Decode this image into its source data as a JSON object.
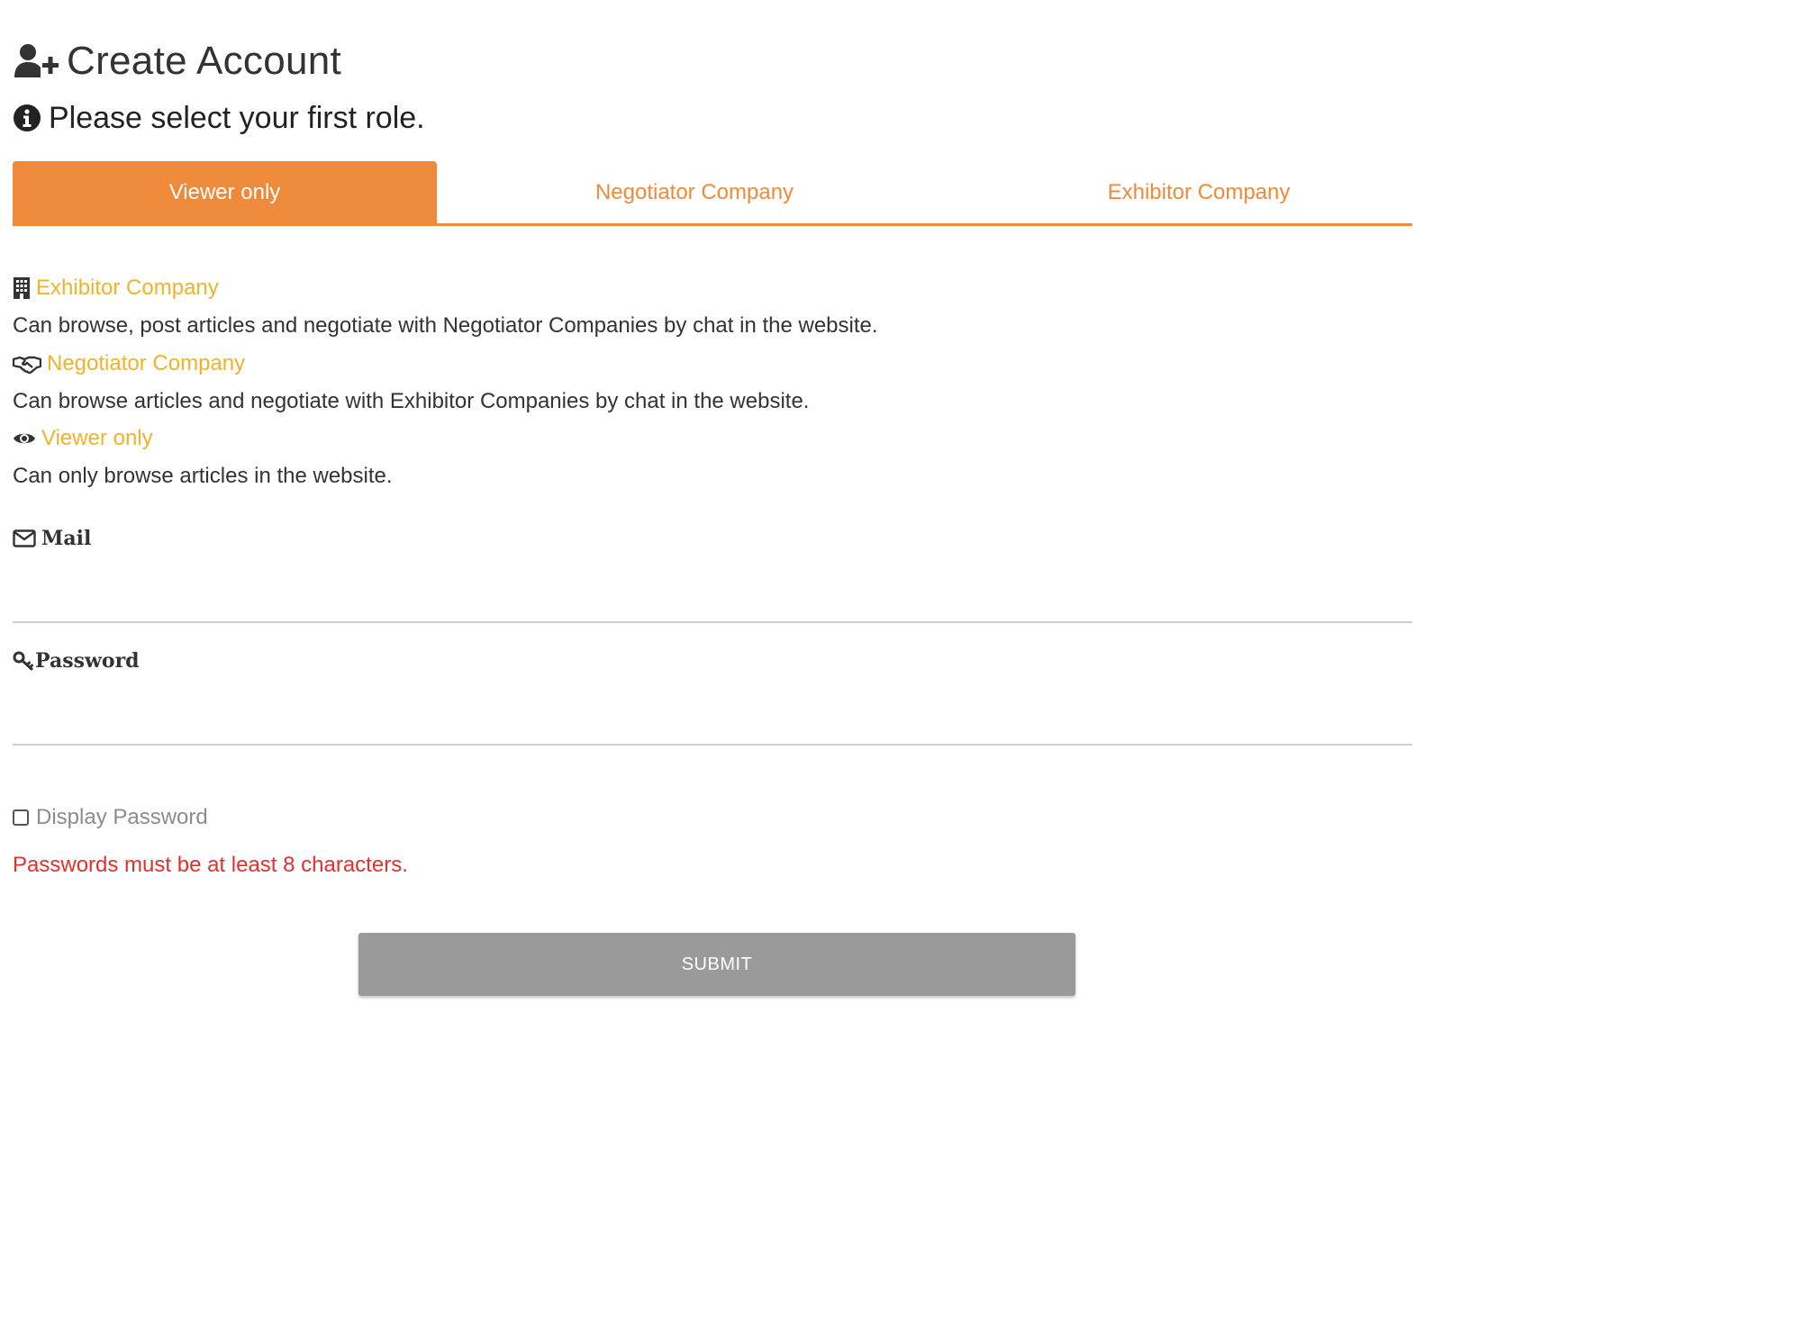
{
  "header": {
    "title": "Create Account",
    "title_icon": "user-plus-icon",
    "subtitle": "Please select your first role.",
    "subtitle_icon": "info-circle-icon"
  },
  "tabs": [
    {
      "label": "Viewer only",
      "active": true
    },
    {
      "label": "Negotiator Company",
      "active": false
    },
    {
      "label": "Exhibitor Company",
      "active": false
    }
  ],
  "roles": [
    {
      "title": "Exhibitor Company",
      "icon": "building-icon",
      "description": "Can browse, post articles and negotiate with Negotiator Companies by chat in the website."
    },
    {
      "title": "Negotiator Company",
      "icon": "handshake-icon",
      "description": "Can browse articles and negotiate with Exhibitor Companies by chat in the website."
    },
    {
      "title": "Viewer only",
      "icon": "eye-icon",
      "description": "Can only browse articles in the website."
    }
  ],
  "form": {
    "mail_label": "Mail",
    "mail_icon": "envelope-icon",
    "mail_value": "",
    "password_label": "Password",
    "password_icon": "key-icon",
    "password_value": "",
    "display_password_label": "Display Password",
    "display_password_checked": false,
    "error_message": "Passwords must be at least 8 characters.",
    "submit_label": "SUBMIT"
  },
  "colors": {
    "accent": "#ee8a3a",
    "role_title": "#f3b227",
    "error": "#e0312e",
    "submit_disabled": "#9a9a9a"
  }
}
